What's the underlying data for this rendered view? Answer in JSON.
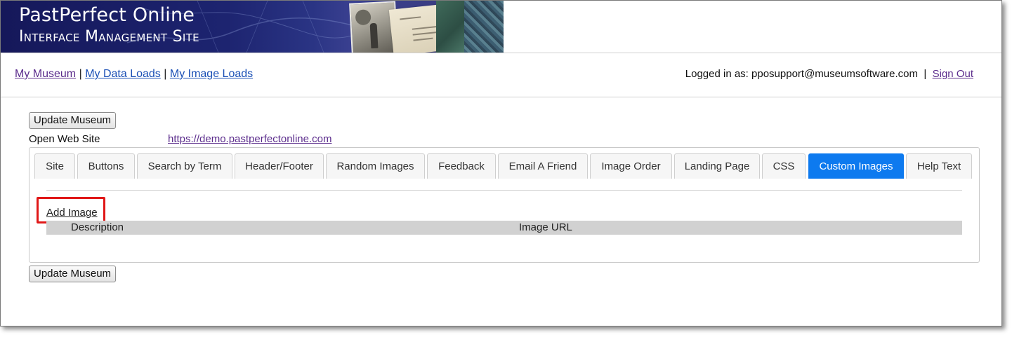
{
  "banner": {
    "title": "PastPerfect Online",
    "subtitle": "Interface Management Site"
  },
  "nav": {
    "my_museum": "My Museum",
    "separator": "|",
    "my_data_loads": "My Data Loads",
    "my_image_loads": "My Image Loads"
  },
  "account": {
    "logged_in_label": "Logged in as: pposupport@museumsoftware.com",
    "separator": "|",
    "sign_out": "Sign Out"
  },
  "actions": {
    "update_museum_top": "Update Museum",
    "update_museum_bottom": "Update Museum"
  },
  "website": {
    "label": "Open Web Site",
    "url": "https://demo.pastperfectonline.com"
  },
  "tabs": [
    {
      "label": "Site"
    },
    {
      "label": "Buttons"
    },
    {
      "label": "Search by Term"
    },
    {
      "label": "Header/Footer"
    },
    {
      "label": "Random Images"
    },
    {
      "label": "Feedback"
    },
    {
      "label": "Email A Friend"
    },
    {
      "label": "Image Order"
    },
    {
      "label": "Landing Page"
    },
    {
      "label": "CSS"
    },
    {
      "label": "Custom Images",
      "active": true
    },
    {
      "label": "Help Text"
    }
  ],
  "custom_images": {
    "add_image": "Add Image",
    "columns": [
      "Description",
      "Image URL"
    ]
  },
  "colors": {
    "active_tab": "#0d7aef",
    "highlight_box": "#e01818",
    "banner": "#1d2470"
  }
}
